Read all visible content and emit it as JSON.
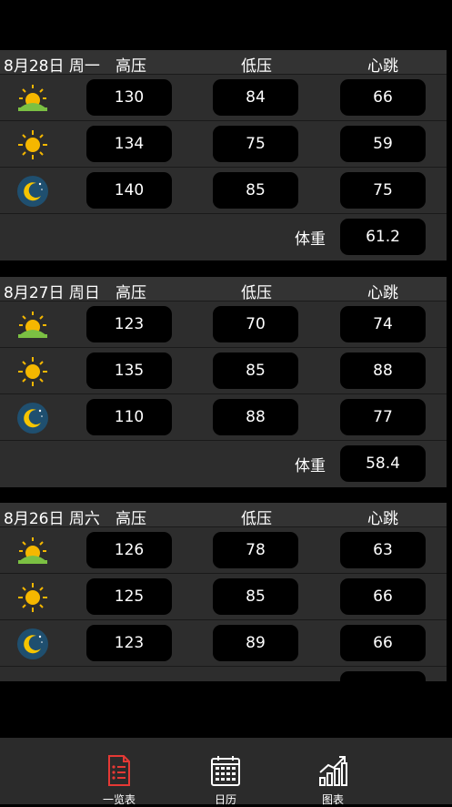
{
  "colors": {
    "active_tab": "#e53935",
    "background": "#000000",
    "card": "#2d2d2d"
  },
  "columns": {
    "high": "高压",
    "low": "低压",
    "pulse": "心跳",
    "weight": "体重"
  },
  "days": [
    {
      "date": "8月28日 周一",
      "rows": [
        {
          "period": "sunrise-icon",
          "high": "130",
          "low": "84",
          "pulse": "66"
        },
        {
          "period": "sun-icon",
          "high": "134",
          "low": "75",
          "pulse": "59"
        },
        {
          "period": "moon-icon",
          "high": "140",
          "low": "85",
          "pulse": "75"
        }
      ],
      "weight": "61.2"
    },
    {
      "date": "8月27日 周日",
      "rows": [
        {
          "period": "sunrise-icon",
          "high": "123",
          "low": "70",
          "pulse": "74"
        },
        {
          "period": "sun-icon",
          "high": "135",
          "low": "85",
          "pulse": "88"
        },
        {
          "period": "moon-icon",
          "high": "110",
          "low": "88",
          "pulse": "77"
        }
      ],
      "weight": "58.4"
    },
    {
      "date": "8月26日 周六",
      "rows": [
        {
          "period": "sunrise-icon",
          "high": "126",
          "low": "78",
          "pulse": "63"
        },
        {
          "period": "sun-icon",
          "high": "125",
          "low": "85",
          "pulse": "66"
        },
        {
          "period": "moon-icon",
          "high": "123",
          "low": "89",
          "pulse": "66"
        }
      ]
    }
  ],
  "tabs": [
    {
      "label": "一览表",
      "icon": "list-icon",
      "active": true
    },
    {
      "label": "日历",
      "icon": "calendar-icon",
      "active": false
    },
    {
      "label": "图表",
      "icon": "chart-icon",
      "active": false
    }
  ]
}
